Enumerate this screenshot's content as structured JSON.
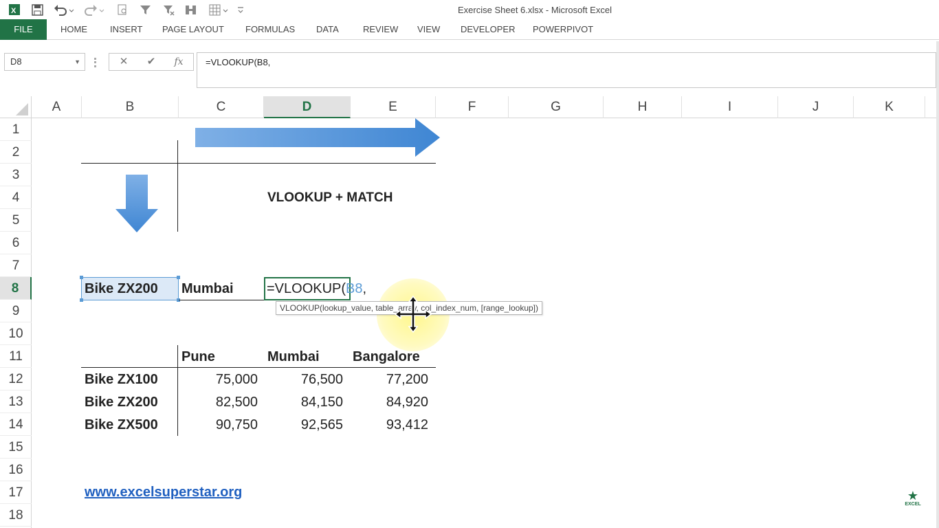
{
  "window": {
    "title": "Exercise Sheet 6.xlsx - Microsoft Excel"
  },
  "qat": {
    "icons": [
      "excel-logo-icon",
      "save-icon",
      "undo-icon",
      "redo-icon",
      "print-preview-icon",
      "filter-icon",
      "clear-filter-icon",
      "freeze-icon",
      "form-icon",
      "customize-icon"
    ]
  },
  "ribbon": {
    "tabs": [
      "FILE",
      "HOME",
      "INSERT",
      "PAGE LAYOUT",
      "FORMULAS",
      "DATA",
      "REVIEW",
      "VIEW",
      "DEVELOPER",
      "POWERPIVOT"
    ]
  },
  "formula_bar": {
    "name_box": "D8",
    "cancel_symbol": "✕",
    "enter_symbol": "✔",
    "fx_symbol": "fx",
    "formula": "=VLOOKUP(B8,"
  },
  "columns": [
    "A",
    "B",
    "C",
    "D",
    "E",
    "F",
    "G",
    "H",
    "I",
    "J",
    "K"
  ],
  "active_column": "D",
  "rows": [
    "1",
    "2",
    "3",
    "4",
    "5",
    "6",
    "7",
    "8",
    "9",
    "10",
    "11",
    "12",
    "13",
    "14",
    "15",
    "16",
    "17",
    "18"
  ],
  "active_row": "8",
  "sheet": {
    "heading": "VLOOKUP + MATCH",
    "lookup_product": "Bike ZX200",
    "lookup_city": "Mumbai",
    "edit_prefix": "=VLOOKUP(",
    "edit_ref": "B8",
    "edit_suffix": ",",
    "tooltip": "VLOOKUP(lookup_value, table_array, col_index_num, [range_lookup])",
    "table": {
      "headers": [
        "Pune",
        "Mumbai",
        "Bangalore"
      ],
      "rows": [
        {
          "label": "Bike ZX100",
          "values": [
            "75,000",
            "76,500",
            "77,200"
          ]
        },
        {
          "label": "Bike ZX200",
          "values": [
            "82,500",
            "84,150",
            "84,920"
          ]
        },
        {
          "label": "Bike ZX500",
          "values": [
            "90,750",
            "92,565",
            "93,412"
          ]
        }
      ]
    },
    "link": "www.excelsuperstar.org",
    "logo_text": "EXCEL"
  },
  "colors": {
    "excel_green": "#217346",
    "ref_blue": "#5b9bd5",
    "arrow_blue": "#4a8fd6",
    "link_blue": "#2060c0"
  }
}
